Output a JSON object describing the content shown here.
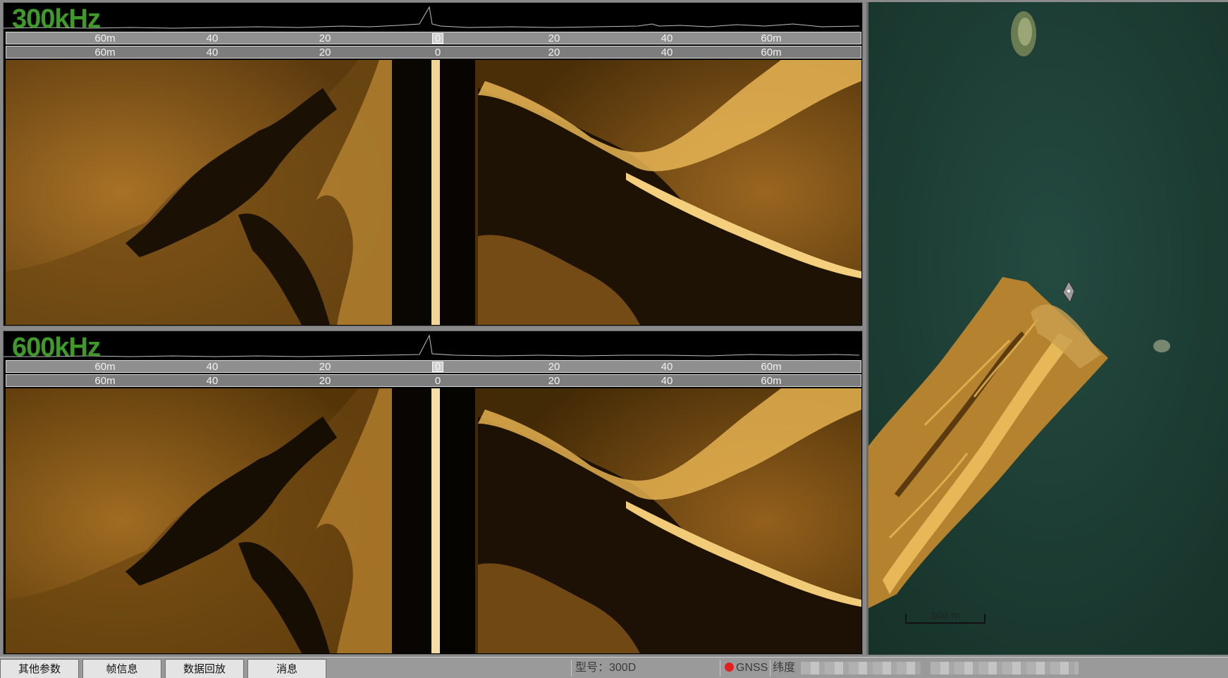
{
  "panels": [
    {
      "id": "panel-300",
      "frequency_label": "300kHz",
      "upper_scale": [
        "60m",
        "40",
        "20",
        "0",
        "20",
        "40",
        "60m"
      ],
      "lower_scale": [
        "60m",
        "40",
        "20",
        "0",
        "20",
        "40",
        "60m"
      ]
    },
    {
      "id": "panel-600",
      "frequency_label": "600kHz",
      "upper_scale": [
        "60m",
        "40",
        "20",
        "0",
        "20",
        "40",
        "60m"
      ],
      "lower_scale": [
        "60m",
        "40",
        "20",
        "0",
        "20",
        "40",
        "60m"
      ]
    }
  ],
  "map": {
    "scale_label": "100 m",
    "water_color": "#1b3c33",
    "mosaic_color": "#c89a3c"
  },
  "colors": {
    "frequency_label": "#3f9a2a",
    "sonar_bright": "#f2c56a",
    "sonar_mid": "#b07a26",
    "sonar_dark": "#2a1a06",
    "gnss_status": "#e12020"
  },
  "statusbar": {
    "tabs": [
      "其他参数",
      "帧信息",
      "数据回放",
      "消息"
    ],
    "model_label": "型号：300D",
    "gnss_label": "GNSS",
    "latitude_label": "纬度"
  }
}
